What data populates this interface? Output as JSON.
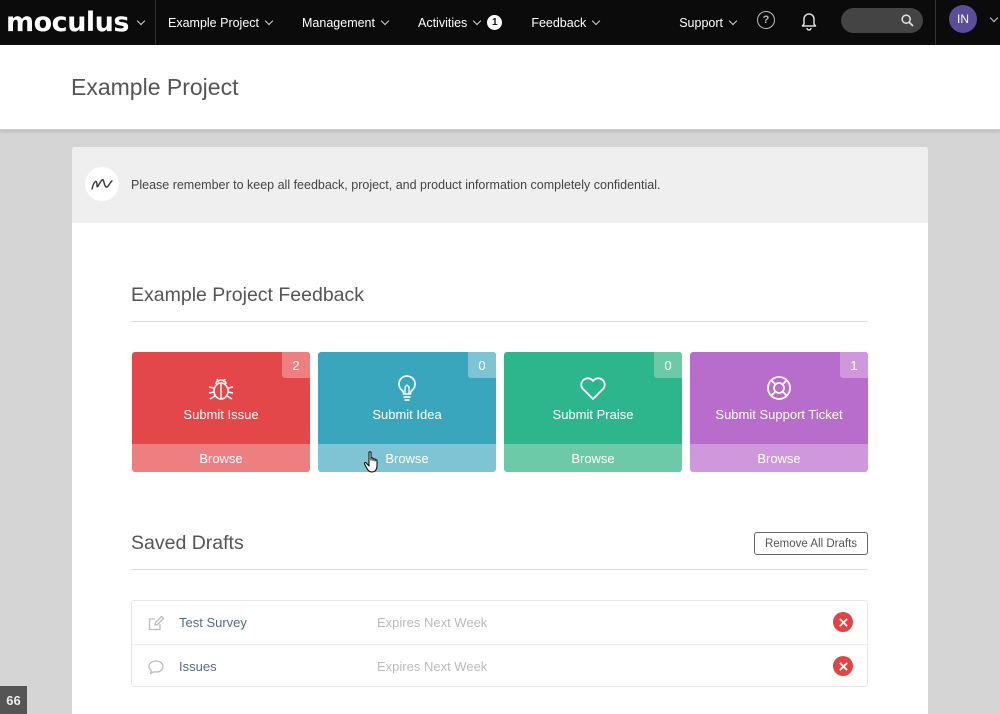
{
  "nav": {
    "brand": "moculus",
    "items": [
      {
        "label": "Example Project"
      },
      {
        "label": "Management"
      },
      {
        "label": "Activities",
        "badge": "1"
      },
      {
        "label": "Feedback"
      },
      {
        "label": "Support"
      }
    ],
    "help_glyph": "?",
    "avatar_initials": "IN"
  },
  "header": {
    "title": "Example Project"
  },
  "notice": {
    "text": "Please remember to keep all feedback, project, and product information completely confidential."
  },
  "feedback": {
    "title": "Example Project Feedback",
    "tiles": [
      {
        "label": "Submit Issue",
        "count": "2",
        "browse": "Browse",
        "icon": "bug-icon",
        "color": "#e4474a",
        "browse_color": "#ee7f80"
      },
      {
        "label": "Submit Idea",
        "count": "0",
        "browse": "Browse",
        "icon": "lightbulb-icon",
        "color": "#3aa6bd",
        "browse_color": "#7ec4d4"
      },
      {
        "label": "Submit Praise",
        "count": "0",
        "browse": "Browse",
        "icon": "heart-icon",
        "color": "#2db58b",
        "browse_color": "#6dcaa9"
      },
      {
        "label": "Submit Support Ticket",
        "count": "1",
        "browse": "Browse",
        "icon": "lifebuoy-icon",
        "color": "#b86dcc",
        "browse_color": "#cf98dc"
      }
    ]
  },
  "drafts": {
    "title": "Saved Drafts",
    "remove_all_label": "Remove All Drafts",
    "rows": [
      {
        "name": "Test Survey",
        "expires": "Expires Next Week",
        "icon": "edit-icon"
      },
      {
        "name": "Issues",
        "expires": "Expires Next Week",
        "icon": "chat-bubble-icon"
      }
    ]
  },
  "quote_tab": "66"
}
